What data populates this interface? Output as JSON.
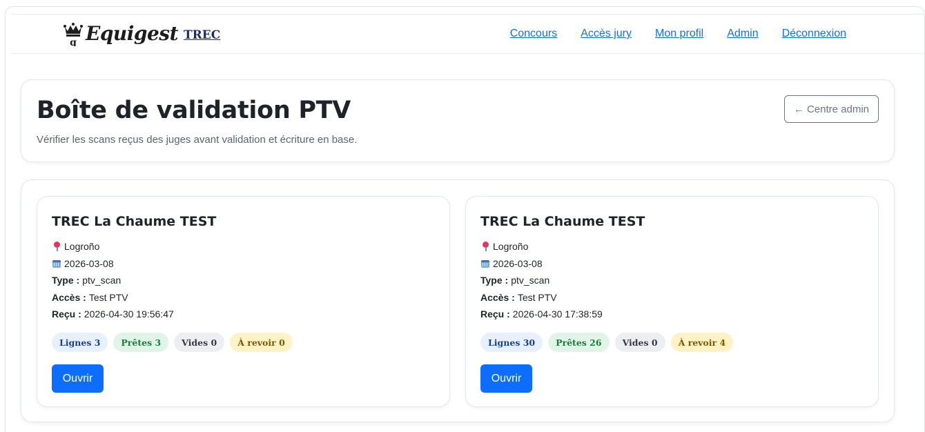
{
  "nav": {
    "brand": "Equigest",
    "brand_sub": "TREC",
    "links": [
      "Concours",
      "Accès jury",
      "Mon profil",
      "Admin",
      "Déconnexion"
    ]
  },
  "header": {
    "title": "Boîte de validation PTV",
    "subtitle": "Vérifier les scans reçus des juges avant validation et écriture en base.",
    "back_button": "← Centre admin"
  },
  "items": [
    {
      "title": "TREC La Chaume TEST",
      "location": "Logroño",
      "date": "2026-03-08",
      "type_label": "Type :",
      "type_value": "ptv_scan",
      "access_label": "Accès :",
      "access_value": "Test PTV",
      "received_label": "Reçu :",
      "received_value": "2026-04-30 19:56:47",
      "badges": {
        "lines": "Lignes 3",
        "ready": "Prêtes 3",
        "empty": "Vides 0",
        "review": "À revoir 0"
      },
      "open_label": "Ouvrir"
    },
    {
      "title": "TREC La Chaume TEST",
      "location": "Logroño",
      "date": "2026-03-08",
      "type_label": "Type :",
      "type_value": "ptv_scan",
      "access_label": "Accès :",
      "access_value": "Test PTV",
      "received_label": "Reçu :",
      "received_value": "2026-04-30 17:38:59",
      "badges": {
        "lines": "Lignes 30",
        "ready": "Prêtes 26",
        "empty": "Vides 0",
        "review": "À revoir 4"
      },
      "open_label": "Ouvrir"
    }
  ],
  "colors": {
    "primary": "#0d6efd",
    "badge_lines_bg": "#e7f0ff",
    "badge_ready_bg": "#e1f4e8",
    "badge_empty_bg": "#eceef1",
    "badge_review_bg": "#fff2c6"
  },
  "icons": {
    "location": "pin-icon",
    "date": "calendar-icon",
    "brand": "crown-logo-icon"
  }
}
